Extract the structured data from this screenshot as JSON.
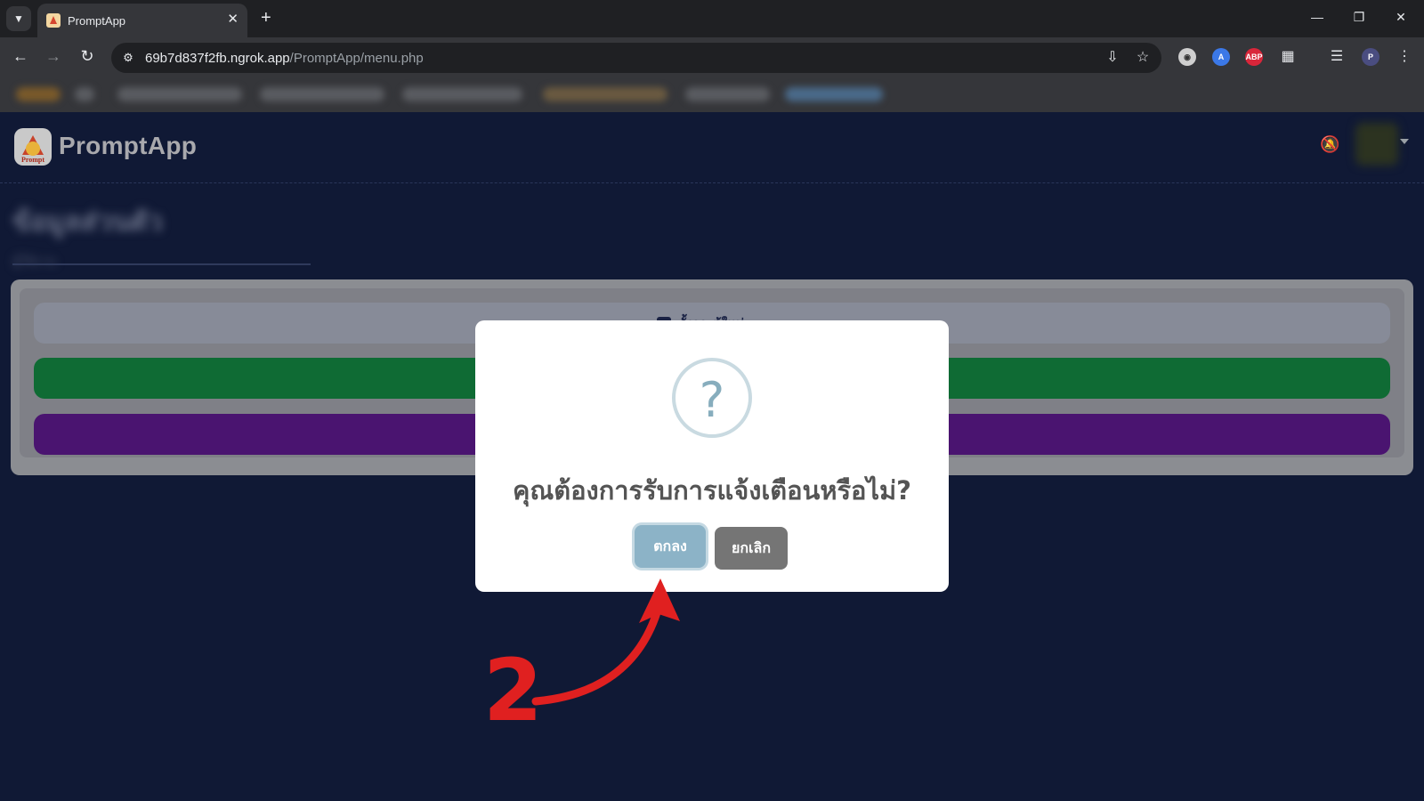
{
  "browser": {
    "tab_title": "PromptApp",
    "url_host": "69b7d837f2fb.ngrok.app",
    "url_path": "/PromptApp/menu.php",
    "extensions": [
      "translate-extension",
      "abp-extension",
      "puzzle-extension"
    ],
    "abp_label": "ABP"
  },
  "app": {
    "brand_name": "PromptApp",
    "logo_text": "Prompt"
  },
  "page": {
    "blurred_title": "ข้อมูลส่วนตัว",
    "blurred_subtitle": "ผู้ใช้งาน",
    "menu_buttons": [
      {
        "label": "ตั้งกระทู้ใหม่",
        "color": "#878b98"
      },
      {
        "label": "",
        "color": "#0f6b34"
      },
      {
        "label": "",
        "color": "#4a1470"
      }
    ]
  },
  "dialog": {
    "icon": "question-icon",
    "icon_glyph": "?",
    "title": "คุณต้องการรับการแจ้งเตือนหรือไม่?",
    "confirm_label": "ตกลง",
    "cancel_label": "ยกเลิก"
  },
  "annotation": {
    "step_number": "2",
    "color": "#e02020"
  },
  "colors": {
    "page_background": "#101935",
    "confirm_button": "#8cb3c7",
    "cancel_button": "#757575"
  }
}
